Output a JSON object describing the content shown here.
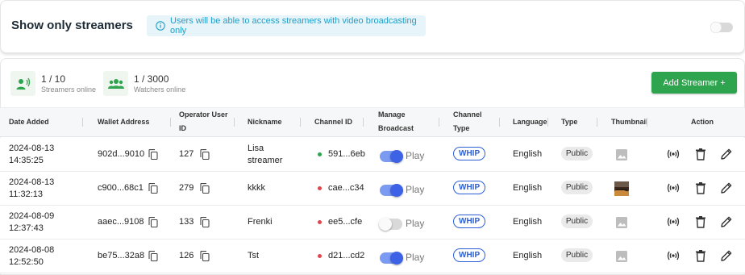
{
  "header": {
    "title": "Show only streamers",
    "info_text": "Users will be able to access streamers with video broadcasting only",
    "toggle_on": false
  },
  "stats": {
    "streamers": {
      "value": "1 / 10",
      "label": "Streamers online"
    },
    "watchers": {
      "value": "1 / 3000",
      "label": "Watchers online"
    }
  },
  "add_button": {
    "label": "Add Streamer +"
  },
  "colors": {
    "accent_green": "#2ea44f",
    "switch_on": "#3d62e6",
    "info_blue": "#1e9ec8",
    "online_dot": "#2ea44f",
    "offline_dot": "#e0474c"
  },
  "table": {
    "columns": {
      "date_added": "Date Added",
      "wallet": "Wallet Address",
      "operator_l1": "Operator User",
      "operator_l2": "ID",
      "nickname": "Nickname",
      "channel_id": "Channel ID",
      "manage_l1": "Manage",
      "manage_l2": "Broadcast",
      "channel_type_l1": "Channel",
      "channel_type_l2": "Type",
      "language": "Language",
      "type": "Type",
      "thumbnail": "Thumbnail",
      "action": "Action"
    },
    "rows": [
      {
        "date": "2024-08-13",
        "time": "14:35:25",
        "wallet": "902d...9010",
        "operator_id": "127",
        "nickname_l1": "Lisa",
        "nickname_l2": "streamer",
        "channel_id": "591...6eb",
        "online": true,
        "broadcast_on": true,
        "play": "Play",
        "channel_type": "WHIP",
        "language": "English",
        "type": "Public",
        "thumbnail": "placeholder"
      },
      {
        "date": "2024-08-13",
        "time": "11:32:13",
        "wallet": "c900...68c1",
        "operator_id": "279",
        "nickname_l1": "kkkk",
        "nickname_l2": "",
        "channel_id": "cae...c34",
        "online": false,
        "broadcast_on": true,
        "play": "Play",
        "channel_type": "WHIP",
        "language": "English",
        "type": "Public",
        "thumbnail": "image"
      },
      {
        "date": "2024-08-09",
        "time": "12:37:43",
        "wallet": "aaec...9108",
        "operator_id": "133",
        "nickname_l1": "Frenki",
        "nickname_l2": "",
        "channel_id": "ee5...cfe",
        "online": false,
        "broadcast_on": false,
        "play": "Play",
        "channel_type": "WHIP",
        "language": "English",
        "type": "Public",
        "thumbnail": "placeholder"
      },
      {
        "date": "2024-08-08",
        "time": "12:52:50",
        "wallet": "be75...32a8",
        "operator_id": "126",
        "nickname_l1": "Tst",
        "nickname_l2": "",
        "channel_id": "d21...cd2",
        "online": false,
        "broadcast_on": true,
        "play": "Play",
        "channel_type": "WHIP",
        "language": "English",
        "type": "Public",
        "thumbnail": "placeholder"
      }
    ]
  }
}
